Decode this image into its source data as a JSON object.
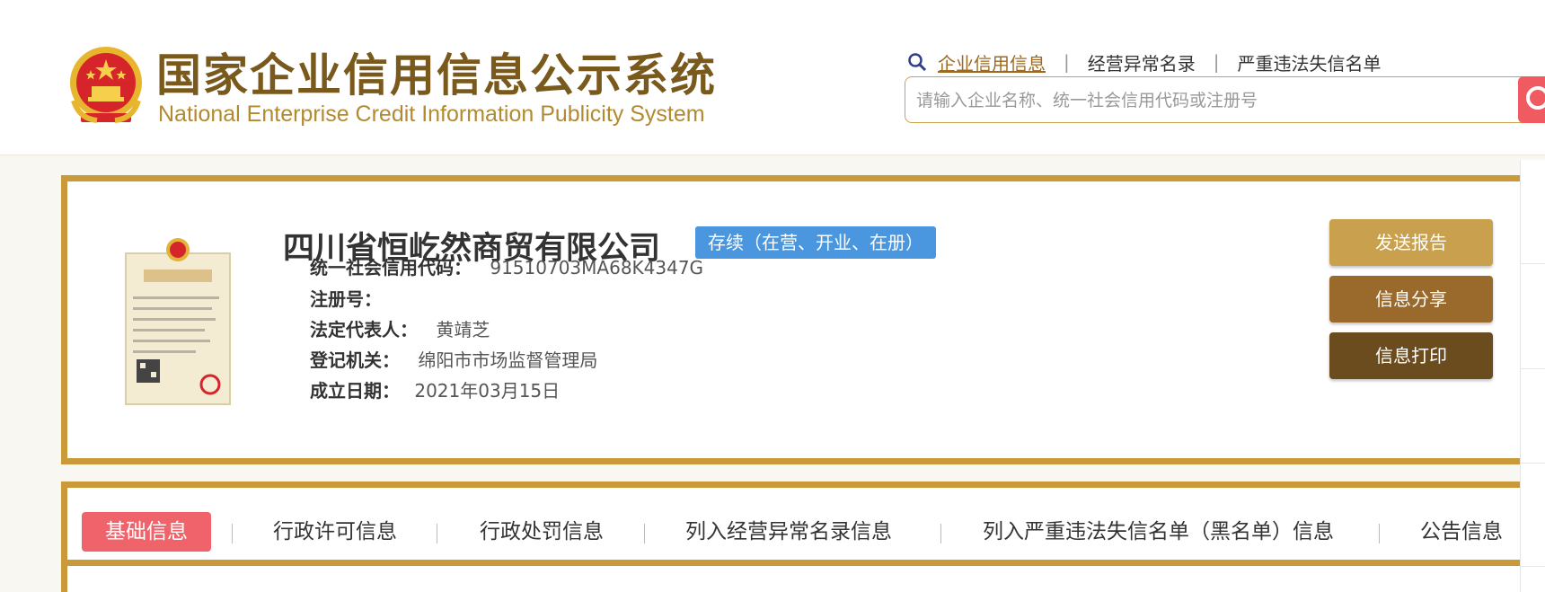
{
  "header": {
    "title_cn": "国家企业信用信息公示系统",
    "title_en": "National Enterprise Credit Information Publicity System",
    "emblem_icon": "national-emblem-icon"
  },
  "top_nav": {
    "items": [
      {
        "label": "企业信用信息",
        "active": true
      },
      {
        "label": "经营异常名录",
        "active": false
      },
      {
        "label": "严重违法失信名单",
        "active": false
      }
    ],
    "separator": "|"
  },
  "search": {
    "placeholder": "请输入企业名称、统一社会信用代码或注册号",
    "button_icon": "search-icon"
  },
  "company": {
    "name": "四川省恒屹然商贸有限公司",
    "status": "存续（在营、开业、在册）",
    "license_icon": "business-license-icon",
    "fields": [
      {
        "label": "统一社会信用代码：",
        "value": "91510703MA68K4347G"
      },
      {
        "label": "注册号：",
        "value": ""
      },
      {
        "label": "法定代表人：",
        "value": "黄靖芝"
      },
      {
        "label": "登记机关：",
        "value": "绵阳市市场监督管理局"
      },
      {
        "label": "成立日期：",
        "value": "2021年03月15日"
      }
    ]
  },
  "actions": [
    {
      "label": "发送报告",
      "color": "#c9a04e"
    },
    {
      "label": "信息分享",
      "color": "#9a6a2c"
    },
    {
      "label": "信息打印",
      "color": "#6a4c1f"
    }
  ],
  "tabs": [
    {
      "label": "基础信息",
      "active": true
    },
    {
      "label": "行政许可信息",
      "active": false
    },
    {
      "label": "行政处罚信息",
      "active": false
    },
    {
      "label": "列入经营异常名录信息",
      "active": false
    },
    {
      "label": "列入严重违法失信名单（黑名单）信息",
      "active": false
    },
    {
      "label": "公告信息",
      "active": false
    }
  ],
  "colors": {
    "gold_border": "#c9993a",
    "title_brown": "#7a5a1c",
    "accent_red": "#f0636a",
    "status_blue": "#4a97e0"
  }
}
